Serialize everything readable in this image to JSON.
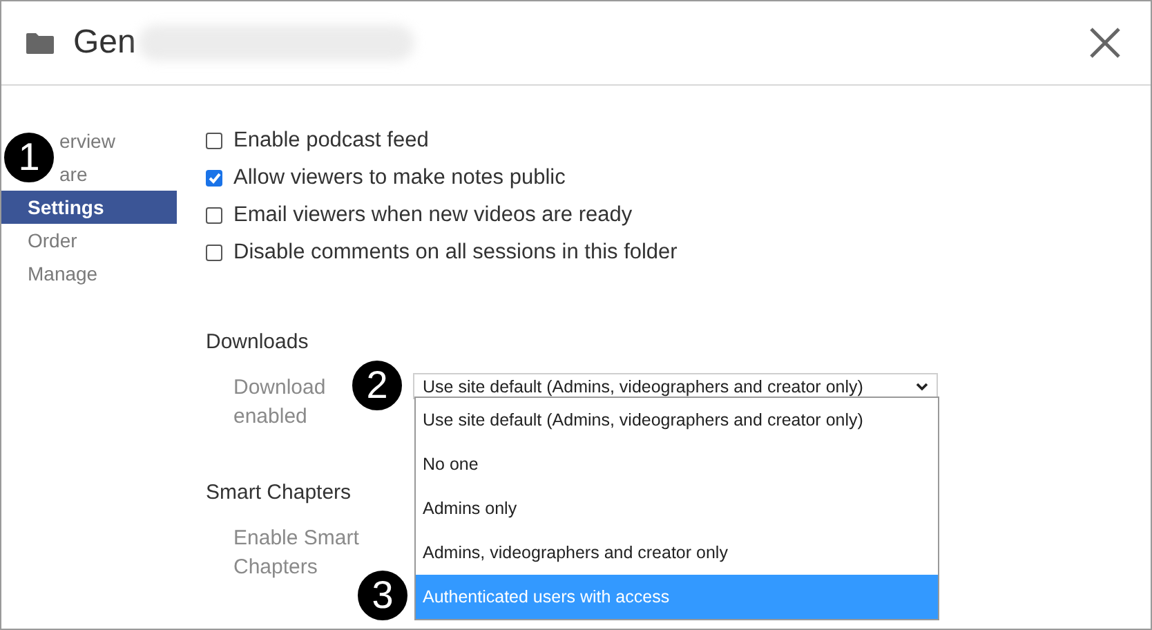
{
  "dialog": {
    "title": "Gen"
  },
  "sidebar": {
    "items": [
      {
        "label": "erview",
        "selected": false
      },
      {
        "label": "are",
        "selected": false
      },
      {
        "label": "Settings",
        "selected": true
      },
      {
        "label": "Order",
        "selected": false
      },
      {
        "label": "Manage",
        "selected": false
      }
    ]
  },
  "options": [
    {
      "label": "Enable podcast feed",
      "checked": false
    },
    {
      "label": "Allow viewers to make notes public",
      "checked": true
    },
    {
      "label": "Email viewers when new videos are ready",
      "checked": false
    },
    {
      "label": "Disable comments on all sessions in this folder",
      "checked": false
    }
  ],
  "downloads": {
    "heading": "Downloads",
    "label": "Download enabled",
    "value": "Use site default (Admins, videographers and creator only)",
    "dropdown": [
      {
        "label": "Use site default (Admins, videographers and creator only)",
        "highlighted": false
      },
      {
        "label": "No one",
        "highlighted": false
      },
      {
        "label": "Admins only",
        "highlighted": false
      },
      {
        "label": "Admins, videographers and creator only",
        "highlighted": false
      },
      {
        "label": "Authenticated users with access",
        "highlighted": true
      }
    ]
  },
  "smart_chapters": {
    "heading": "Smart Chapters",
    "label": "Enable Smart Chapters"
  },
  "callouts": [
    "1",
    "2",
    "3"
  ]
}
